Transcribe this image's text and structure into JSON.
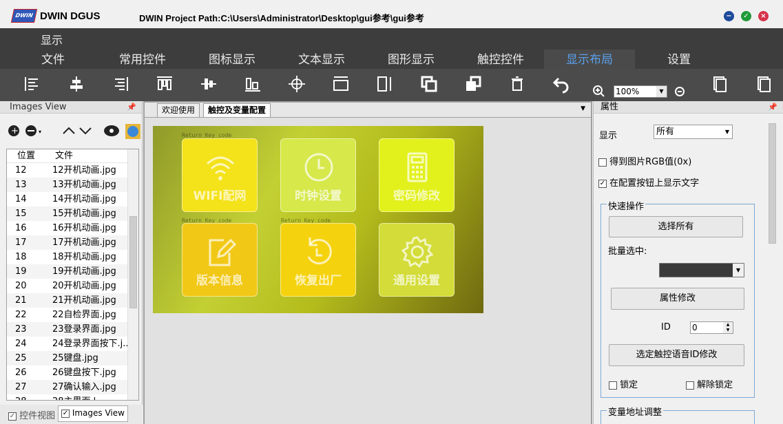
{
  "title_bar": {
    "app_name": "DWIN DGUS",
    "path": "DWIN Project Path:C:\\Users\\Administrator\\Desktop\\gui参考\\gui参考",
    "logo_text": "DWIN"
  },
  "ribbon": {
    "display_label": "显示",
    "tabs": [
      {
        "label": "文件"
      },
      {
        "label": "常用控件"
      },
      {
        "label": "图标显示"
      },
      {
        "label": "文本显示"
      },
      {
        "label": "图形显示"
      },
      {
        "label": "触控控件"
      },
      {
        "label": "显示布局",
        "active": true
      },
      {
        "label": "设置"
      }
    ]
  },
  "toolbar": {
    "zoom": "100%"
  },
  "left_panel": {
    "title": "Images View",
    "columns": [
      "位置",
      "文件"
    ],
    "rows": [
      {
        "n": "12",
        "f": "12开机动画.jpg"
      },
      {
        "n": "13",
        "f": "13开机动画.jpg"
      },
      {
        "n": "14",
        "f": "14开机动画.jpg"
      },
      {
        "n": "15",
        "f": "15开机动画.jpg"
      },
      {
        "n": "16",
        "f": "16开机动画.jpg"
      },
      {
        "n": "17",
        "f": "17开机动画.jpg"
      },
      {
        "n": "18",
        "f": "18开机动画.jpg"
      },
      {
        "n": "19",
        "f": "19开机动画.jpg"
      },
      {
        "n": "20",
        "f": "20开机动画.jpg"
      },
      {
        "n": "21",
        "f": "21开机动画.jpg"
      },
      {
        "n": "22",
        "f": "22自检界面.jpg"
      },
      {
        "n": "23",
        "f": "23登录界面.jpg"
      },
      {
        "n": "24",
        "f": "24登录界面按下.j..."
      },
      {
        "n": "25",
        "f": "25键盘.jpg"
      },
      {
        "n": "26",
        "f": "26键盘按下.jpg"
      },
      {
        "n": "27",
        "f": "27确认输入.jpg"
      },
      {
        "n": "28",
        "f": "28主界面.l"
      }
    ],
    "bottom_tabs": [
      {
        "label": "控件视图"
      },
      {
        "label": "Images View"
      }
    ]
  },
  "center": {
    "tabs": [
      {
        "label": "欢迎使用"
      },
      {
        "label": "触控及变量配置",
        "active": true
      }
    ],
    "tag_text": "Return Key code",
    "tiles": [
      {
        "label": "WIFI配网"
      },
      {
        "label": "时钟设置"
      },
      {
        "label": "密码修改"
      },
      {
        "label": "版本信息"
      },
      {
        "label": "恢复出厂"
      },
      {
        "label": "通用设置"
      }
    ]
  },
  "right_panel": {
    "title": "属性",
    "display_label": "显示",
    "display_value": "所有",
    "rgb_label": "得到图片RGB值(0x)",
    "show_text_label": "在配置按钮上显示文字",
    "quick_ops_title": "快速操作",
    "select_all": "选择所有",
    "batch_label": "批量选中:",
    "attr_modify": "属性修改",
    "id_label": "ID",
    "id_value": "0",
    "voice_btn": "选定触控语音ID修改",
    "lock": "锁定",
    "unlock": "解除锁定",
    "var_title": "变量地址调整"
  }
}
